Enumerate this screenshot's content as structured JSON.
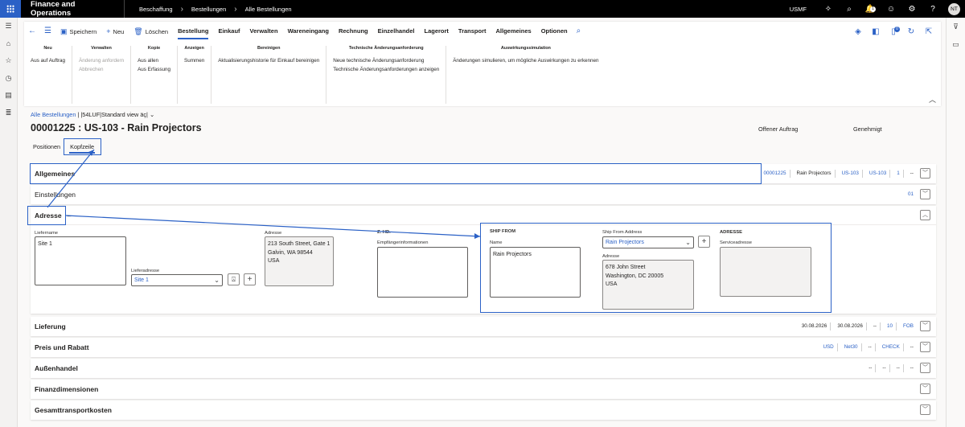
{
  "topbar": {
    "app_title": "Finance and Operations",
    "breadcrumbs": [
      "Beschaffung",
      "Bestellungen",
      "Alle Bestellungen"
    ],
    "company": "USMF",
    "notification_count": "1",
    "avatar_initials": "NT"
  },
  "actionpane": {
    "tabs": [
      {
        "label": "Speichern",
        "glyph": "💾",
        "kind": "btn"
      },
      {
        "label": "Neu",
        "glyph": "+",
        "kind": "btn"
      },
      {
        "label": "Löschen",
        "glyph": "🗑",
        "kind": "btn"
      },
      {
        "label": "Bestellung",
        "kind": "active"
      },
      {
        "label": "Einkauf",
        "kind": "bold"
      },
      {
        "label": "Verwalten",
        "kind": "bold"
      },
      {
        "label": "Wareneingang",
        "kind": "bold"
      },
      {
        "label": "Rechnung",
        "kind": "bold"
      },
      {
        "label": "Einzelhandel",
        "kind": "bold"
      },
      {
        "label": "Lagerort",
        "kind": "bold"
      },
      {
        "label": "Transport",
        "kind": "bold"
      },
      {
        "label": "Allgemeines",
        "kind": "bold"
      },
      {
        "label": "Optionen",
        "kind": "bold"
      }
    ],
    "attachment_count": "0",
    "groups": [
      {
        "header": "Neu",
        "items": [
          {
            "label": "Aus auf Auftrag",
            "disabled": false
          }
        ]
      },
      {
        "header": "Verwalten",
        "items": [
          {
            "label": "Änderung anfordern",
            "disabled": true
          },
          {
            "label": "Abbrechen",
            "disabled": true
          }
        ]
      },
      {
        "header": "Kopie",
        "items": [
          {
            "label": "Aus allen",
            "disabled": false
          },
          {
            "label": "Aus Erfassung",
            "disabled": false
          }
        ]
      },
      {
        "header": "Anzeigen",
        "items": [
          {
            "label": "Summen",
            "disabled": false
          }
        ]
      },
      {
        "header": "Bereinigen",
        "items": [
          {
            "label": "Aktualisierungshistorie für Einkauf bereinigen",
            "disabled": false
          }
        ]
      },
      {
        "header": "Technische Änderungsanforderung",
        "items": [
          {
            "label": "Neue technische Änderungsanforderung",
            "disabled": false
          },
          {
            "label": "Technische Änderungsanforderungen anzeigen",
            "disabled": false
          }
        ]
      },
      {
        "header": "Auswirkungssimulation",
        "items": [
          {
            "label": "Änderungen simulieren, um mögliche Auswirkungen zu erkennen",
            "disabled": false
          }
        ]
      }
    ]
  },
  "header": {
    "breadcrumb_link": "Alle Bestellungen",
    "breadcrumb_sep": "|",
    "view_name": "|54LUF|Standard view äç|",
    "title": "00001225 : US-103 - Rain Projectors",
    "status_doc": "Offener Auftrag",
    "status_approval": "Genehmigt"
  },
  "page_tabs": [
    "Positionen",
    "Kopfzeile"
  ],
  "fasttabs": {
    "allgemeines": {
      "title": "Allgemeines",
      "summary": [
        "00001225",
        "Rain Projectors",
        "US-103",
        "US-103",
        "1",
        "--"
      ]
    },
    "einstellungen": {
      "title": "Einstellungen",
      "summary": [
        "01"
      ]
    },
    "adresse": {
      "title": "Adresse",
      "title_dash": "–"
    },
    "lieferung": {
      "title": "Lieferung",
      "summary": [
        "30.08.2026",
        "30.08.2026",
        "--",
        "10",
        "FOB"
      ]
    },
    "preis": {
      "title": "Preis und Rabatt",
      "summary": [
        "USD",
        "Net30",
        "--",
        "CHECK",
        "--"
      ]
    },
    "aussenhandel": {
      "title": "Außenhandel",
      "summary": [
        "--",
        "--",
        "--",
        "--"
      ]
    },
    "finanz": {
      "title": "Finanzdimensionen"
    },
    "gesamt": {
      "title": "Gesamttransportkosten"
    }
  },
  "address": {
    "liefername_label": "Liefername",
    "liefername_value": "Site 1",
    "lieferadresse_label": "Lieferadresse",
    "lieferadresse_value": "Site 1",
    "adresse_label": "Adresse",
    "adresse_lines": [
      "213 South Street, Gate 1",
      "Galvin, WA 98544",
      "USA"
    ],
    "zhd_header": "Z. HD.",
    "empfaenger_label": "Empfängerinformationen",
    "ship_from_header": "SHIP FROM",
    "name_label": "Name",
    "name_value": "Rain Projectors",
    "ship_from_address_label": "Ship From Address",
    "ship_from_address_value": "Rain Projectors",
    "ship_adresse_label": "Adresse",
    "ship_adresse_lines": [
      "678 John Street",
      "Washington, DC 20005",
      "USA"
    ],
    "adresse_header": "ADRESSE",
    "serviceadresse_label": "Serviceadresse"
  },
  "colors": {
    "accent": "#2b61c6",
    "topbar": "#000000"
  }
}
